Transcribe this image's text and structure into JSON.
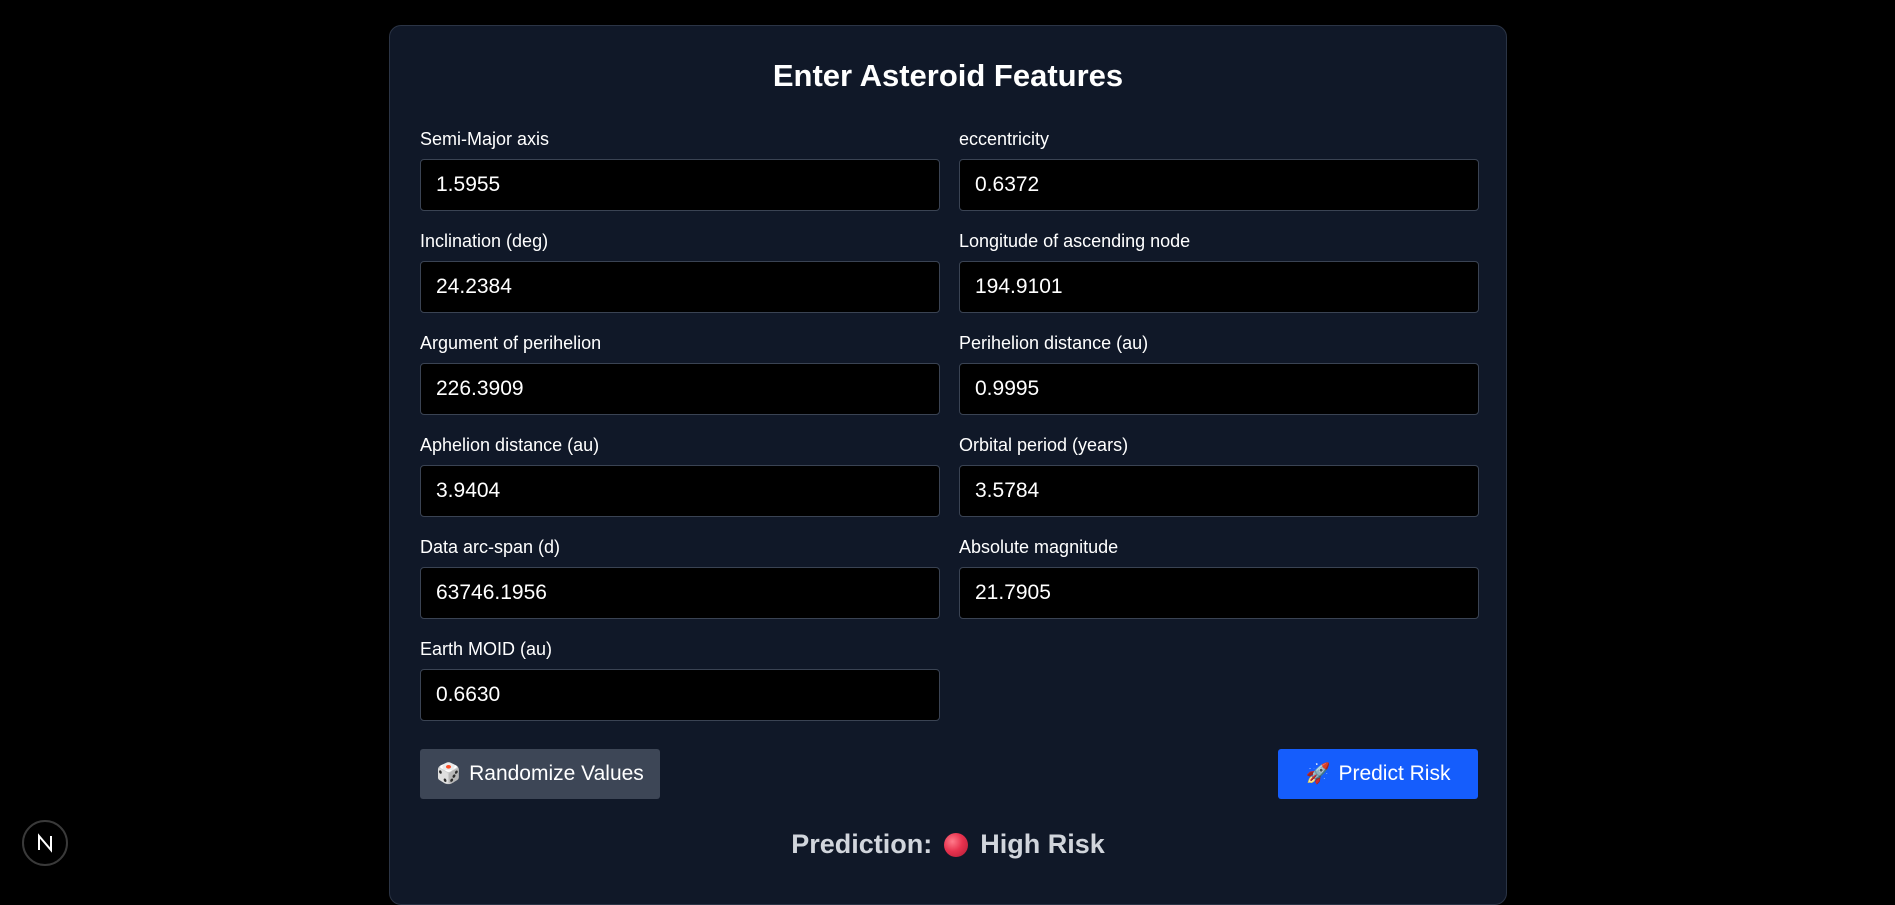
{
  "form": {
    "title": "Enter Asteroid Features",
    "fields": [
      {
        "label": "Semi-Major axis",
        "value": "1.5955"
      },
      {
        "label": "eccentricity",
        "value": "0.6372"
      },
      {
        "label": "Inclination (deg)",
        "value": "24.2384"
      },
      {
        "label": "Longitude of ascending node",
        "value": "194.9101"
      },
      {
        "label": "Argument of perihelion",
        "value": "226.3909"
      },
      {
        "label": "Perihelion distance (au)",
        "value": "0.9995"
      },
      {
        "label": "Aphelion distance (au)",
        "value": "3.9404"
      },
      {
        "label": "Orbital period (years)",
        "value": "3.5784"
      },
      {
        "label": "Data arc-span (d)",
        "value": "63746.1956"
      },
      {
        "label": "Absolute magnitude",
        "value": "21.7905"
      },
      {
        "label": "Earth MOID (au)",
        "value": "0.6630"
      }
    ]
  },
  "buttons": {
    "randomize_icon": "🎲",
    "randomize_label": "Randomize Values",
    "predict_icon": "🚀",
    "predict_label": "Predict Risk"
  },
  "prediction": {
    "label": "Prediction:",
    "result": "High Risk",
    "indicator_color": "#e8334f"
  },
  "badge": {
    "icon": "next-logo-icon"
  },
  "colors": {
    "background": "#000000",
    "panel": "#101828",
    "input_bg": "#000000",
    "randomize_button": "#3d4656",
    "predict_button": "#155dfc"
  }
}
